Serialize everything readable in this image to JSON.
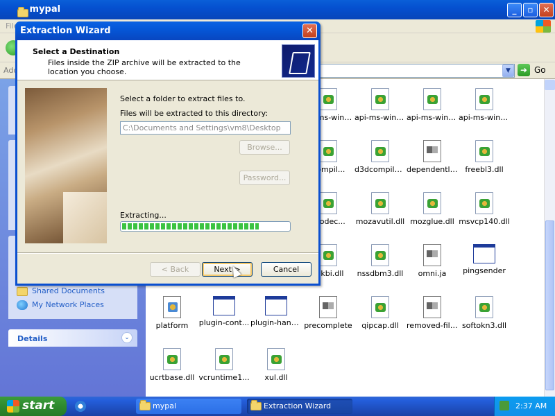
{
  "explorer": {
    "title": "mypal",
    "menu_first": "File",
    "address_label": "Address",
    "go_label": "Go"
  },
  "task_pane": {
    "links": [
      "Shared Documents",
      "My Network Places"
    ],
    "details_header": "Details"
  },
  "files": [
    {
      "name": "api-ms-win-...",
      "type": "dll"
    },
    {
      "name": "api-ms-win-...",
      "type": "dll"
    },
    {
      "name": "api-ms-win-...",
      "type": "dll"
    },
    {
      "name": "api-ms-win-...",
      "type": "dll"
    },
    {
      "name": "Compil...",
      "type": "dll"
    },
    {
      "name": "d3dcompiler...",
      "type": "dll"
    },
    {
      "name": "dependentli...",
      "type": "ja"
    },
    {
      "name": "freebl3.dll",
      "type": "dll"
    },
    {
      "name": "vcodec...",
      "type": "dll"
    },
    {
      "name": "mozavutil.dll",
      "type": "dll"
    },
    {
      "name": "mozglue.dll",
      "type": "dll"
    },
    {
      "name": "msvcp140.dll",
      "type": "dll"
    },
    {
      "name": "sckbi.dll",
      "type": "dll"
    },
    {
      "name": "nssdbm3.dll",
      "type": "dll"
    },
    {
      "name": "omni.ja",
      "type": "ja"
    },
    {
      "name": "pingsender",
      "type": "exe"
    },
    {
      "name": "platform",
      "type": "app"
    },
    {
      "name": "plugin-cont...",
      "type": "exe"
    },
    {
      "name": "plugin-hang-ui",
      "type": "exe"
    },
    {
      "name": "precomplete",
      "type": "ja"
    },
    {
      "name": "qipcap.dll",
      "type": "dll"
    },
    {
      "name": "removed-files",
      "type": "ja"
    },
    {
      "name": "softokn3.dll",
      "type": "dll"
    },
    {
      "name": "ucrtbase.dll",
      "type": "dll"
    },
    {
      "name": "vcruntime1...",
      "type": "dll"
    },
    {
      "name": "xul.dll",
      "type": "dll"
    }
  ],
  "wizard": {
    "title": "Extraction Wizard",
    "heading": "Select a Destination",
    "subheading": "Files inside the ZIP archive will be extracted to the location you choose.",
    "select_label": "Select a folder to extract files to.",
    "dir_label": "Files will be extracted to this directory:",
    "dir_value": "C:\\Documents and Settings\\vm8\\Desktop",
    "browse_label": "Browse...",
    "password_label": "Password...",
    "extracting_label": "Extracting...",
    "progress": 0.82,
    "back_label": "< Back",
    "next_label": "Next >",
    "cancel_label": "Cancel"
  },
  "taskbar": {
    "start_label": "start",
    "tasks": [
      "mypal",
      "Extraction Wizard"
    ],
    "clock": "2:37 AM"
  },
  "colors": {
    "xp_blue": "#0a5fd8",
    "task_pane": "#7ba2e7",
    "progress_green": "#3bc341"
  }
}
